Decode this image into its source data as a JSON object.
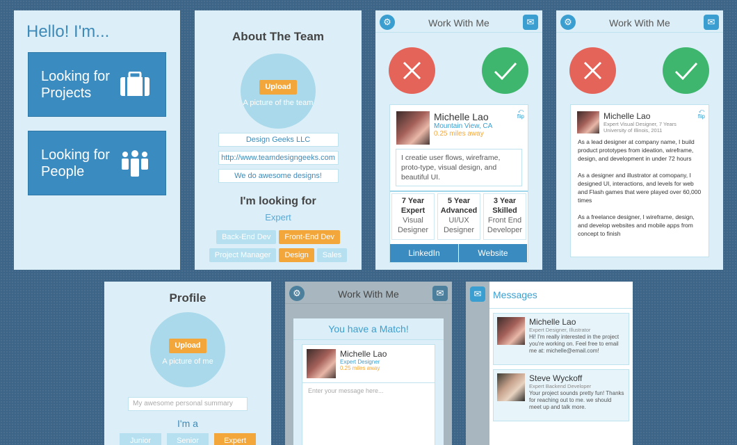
{
  "welcome": {
    "greeting": "Hello! I'm...",
    "projects_btn": "Looking for Projects",
    "people_btn": "Looking for People"
  },
  "team": {
    "title": "About The Team",
    "upload": "Upload",
    "photo_hint": "A picture of the team",
    "company": "Design Geeks LLC",
    "website": "http://www.teamdesigngeeks.com",
    "tagline": "We do awesome designs!",
    "looking_for": "I'm looking for",
    "level": "Expert",
    "tags": [
      {
        "label": "Back-End Dev",
        "on": false
      },
      {
        "label": "Front-End Dev",
        "on": true
      },
      {
        "label": "Project Manager",
        "on": false
      },
      {
        "label": "Design",
        "on": true
      },
      {
        "label": "Sales",
        "on": false
      }
    ]
  },
  "work": {
    "title": "Work With Me",
    "flip": "flip",
    "profile": {
      "name": "Michelle Lao",
      "location": "Mountain View, CA",
      "distance": "0.25 miles away",
      "bio": "I creatie user flows, wireframe, proto-type, visual design, and beautiful UI.",
      "stats": [
        {
          "top": "7 Year",
          "top2": "Expert",
          "sub": "Visual Designer"
        },
        {
          "top": "5 Year",
          "top2": "Advanced",
          "sub": "UI/UX Designer"
        },
        {
          "top": "3 Year",
          "top2": "Skilled",
          "sub": "Front End Developer"
        }
      ],
      "linkedin": "LinkedIn",
      "website": "Website"
    },
    "detail": {
      "name": "Michelle Lao",
      "role": "Expert Visual Designer, 7 Years",
      "school": "University of Illinois, 2011",
      "p1": "As a lead designer at company name, I build product prototypes from ideation, wireframe, design, and development in under 72 hours",
      "p2": "As a designer and illustrator at comopany, I designed UI, interactions, and levels for web and Flash games that were played over 60,000 times",
      "p3": "As a freelance designer, I wireframe, design, and develop websites and mobile apps from concept to finish"
    }
  },
  "profile": {
    "title": "Profile",
    "upload": "Upload",
    "photo_hint": "A picture of me",
    "summary_placeholder": "My awesome personal summary",
    "ima": "I'm a",
    "levels": [
      {
        "label": "Junior",
        "on": false
      },
      {
        "label": "Senior",
        "on": false
      },
      {
        "label": "Expert",
        "on": true
      }
    ]
  },
  "match": {
    "header": "Work With Me",
    "title": "You have a Match!",
    "name": "Michelle Lao",
    "role": "Expert Designer",
    "distance": "0.25 miles away",
    "placeholder": "Enter your message here..."
  },
  "messages": {
    "title": "Messages",
    "items": [
      {
        "name": "Michelle Lao",
        "role": "Expert Designer, Illustrator",
        "text": "Hi! I'm really interested in the project you're working on. Feel free to email me at: michelle@email.com!"
      },
      {
        "name": "Steve Wyckoff",
        "role": "Expert Backend Developer",
        "text": "Your project sounds pretty fun! Thanks for reaching out to me. we should meet up and talk more."
      }
    ]
  },
  "colors": {
    "primary": "#3a8bbf",
    "accent": "#f3a73a",
    "reject": "#e5645a",
    "accept": "#3fb66d",
    "panel": "#dceff8"
  }
}
